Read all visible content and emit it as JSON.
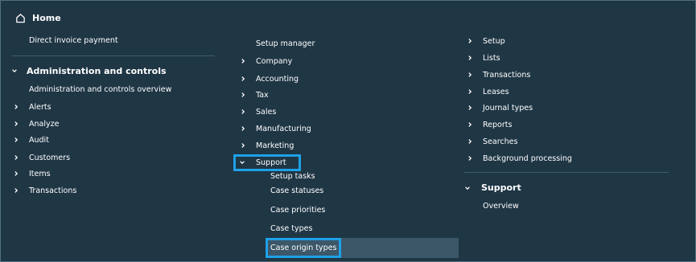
{
  "left": {
    "home_label": "Home",
    "direct_invoice": "Direct invoice payment",
    "admin_header": "Administration and controls",
    "admin_overview": "Administration and controls overview",
    "items": [
      "Alerts",
      "Analyze",
      "Audit",
      "Customers",
      "Items",
      "Transactions"
    ]
  },
  "middle": {
    "setup_manager": "Setup manager",
    "items": [
      "Company",
      "Accounting",
      "Tax",
      "Sales",
      "Manufacturing",
      "Marketing"
    ],
    "support": "Support",
    "support_children": [
      "Setup tasks",
      "Case statuses",
      "Case priorities",
      "Case types",
      "Case origin types"
    ]
  },
  "right": {
    "items": [
      "Setup",
      "Lists",
      "Transactions",
      "Leases",
      "Journal types",
      "Reports",
      "Searches",
      "Background processing"
    ],
    "support_header": "Support",
    "support_overview": "Overview"
  },
  "colors": {
    "background": "#1f3645",
    "highlight": "#1ea1e8",
    "selected_bg": "#3b5768"
  }
}
